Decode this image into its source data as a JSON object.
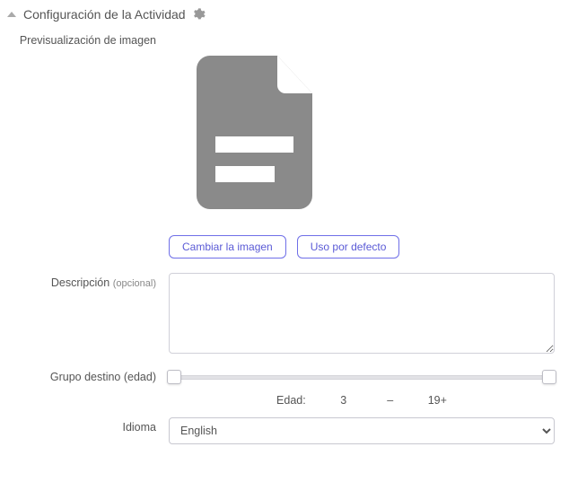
{
  "section": {
    "title": "Configuración de la Actividad"
  },
  "labels": {
    "preview": "Previsualización de imagen",
    "description": "Descripción",
    "description_optional": "(opcional)",
    "target_group": "Grupo destino (edad)",
    "language": "Idioma",
    "age_prefix": "Edad:",
    "age_separator": "–"
  },
  "buttons": {
    "change_image": "Cambiar la imagen",
    "use_default": "Uso por defecto"
  },
  "description_value": "",
  "age": {
    "min": "3",
    "max": "19+"
  },
  "language": {
    "selected": "English",
    "options": [
      "English"
    ]
  },
  "icons": {
    "gear": "gear-icon",
    "caret_up": "caret-up-icon",
    "document": "document-icon"
  }
}
